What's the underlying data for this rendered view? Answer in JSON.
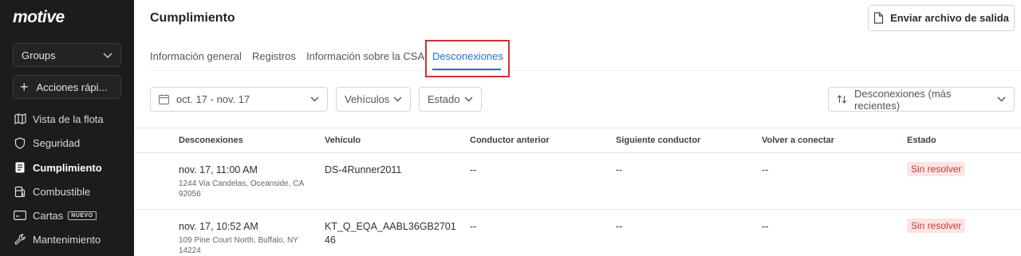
{
  "brand": {
    "logo": "motive"
  },
  "sidebar": {
    "groups_label": "Groups",
    "actions_label": "Acciones rápi...",
    "items": [
      {
        "label": "Vista de la flota",
        "icon": "map-icon"
      },
      {
        "label": "Seguridad",
        "icon": "shield-icon"
      },
      {
        "label": "Cumplimiento",
        "icon": "document-icon",
        "active": true
      },
      {
        "label": "Combustible",
        "icon": "fuel-icon"
      },
      {
        "label": "Cartas",
        "icon": "card-icon",
        "badge": "NUEVO"
      },
      {
        "label": "Mantenimiento",
        "icon": "wrench-icon"
      }
    ]
  },
  "header": {
    "title": "Cumplimiento",
    "export_label": "Enviar archivo de salida"
  },
  "tabs": [
    {
      "label": "Información general"
    },
    {
      "label": "Registros"
    },
    {
      "label": "Información sobre la CSA"
    },
    {
      "label": "Desconexiones",
      "active": true
    }
  ],
  "filters": {
    "date_range": "oct. 17 - nov. 17",
    "vehicles": "Vehículos",
    "status": "Estado",
    "sort": "Desconexiones (más recientes)"
  },
  "table": {
    "columns": [
      "Desconexiones",
      "Vehículo",
      "Conductor anterior",
      "Siguiente conductor",
      "Volver a conectar",
      "Estado"
    ],
    "rows": [
      {
        "time": "nov. 17, 11:00 AM",
        "address": "1244 Via Candelas, Oceanside, CA 92056",
        "vehicle": "DS-4Runner2011",
        "prev_driver": "--",
        "next_driver": "--",
        "reconnect": "--",
        "status": "Sin resolver"
      },
      {
        "time": "nov. 17, 10:52 AM",
        "address": "109 Pine Court North, Buffalo, NY 14224",
        "vehicle": "KT_Q_EQA_AABL36GB270146",
        "prev_driver": "--",
        "next_driver": "--",
        "reconnect": "--",
        "status": "Sin resolver"
      }
    ]
  },
  "colors": {
    "sidebar_bg": "#1c1c1e",
    "accent": "#1d73d6",
    "status_bg": "#fde4e4",
    "status_text": "#c23a3a",
    "highlight_border": "#d32f2f"
  }
}
